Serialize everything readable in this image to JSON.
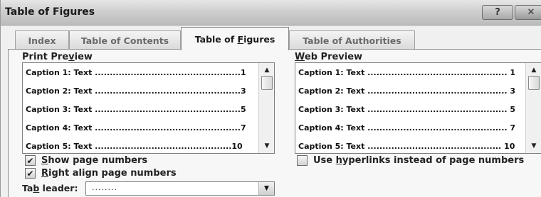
{
  "window": {
    "title": "Table of Figures",
    "help_label": "?",
    "close_label": "✕"
  },
  "tabs": [
    {
      "label_pre": "Index",
      "accel": "",
      "label_post": ""
    },
    {
      "label_pre": "Table of Contents",
      "accel": "",
      "label_post": ""
    },
    {
      "label_pre": "Table of ",
      "accel": "F",
      "label_post": "igures",
      "active": true
    },
    {
      "label_pre": "Table of Authorities",
      "accel": "",
      "label_post": ""
    }
  ],
  "print_preview": {
    "label_pre": "Print Pre",
    "label_accel": "v",
    "label_post": "iew",
    "rows": [
      "Caption 1: Text .................................................1",
      "Caption 2: Text .................................................3",
      "Caption 3: Text .................................................5",
      "Caption 4: Text .................................................7",
      "Caption 5: Text ..............................................10"
    ]
  },
  "web_preview": {
    "label_accel": "W",
    "label_post": "eb Preview",
    "rows": [
      "Caption 1: Text ............................................... 1",
      "Caption 2: Text ............................................... 3",
      "Caption 3: Text ............................................... 5",
      "Caption 4: Text ............................................... 7",
      "Caption 5: Text ............................................. 10"
    ]
  },
  "options": {
    "show_page_numbers": {
      "accel": "S",
      "rest": "how page numbers",
      "checked": true
    },
    "right_align": {
      "accel": "R",
      "rest": "ight align page numbers",
      "checked": true
    },
    "hyperlinks": {
      "pre": "Use ",
      "accel": "h",
      "rest": "yperlinks instead of page numbers",
      "checked": false
    }
  },
  "tab_leader": {
    "label_pre": "Ta",
    "label_accel": "b",
    "label_post": " leader:",
    "value": "........"
  },
  "glyphs": {
    "check": "✔",
    "arrow_up": "▲",
    "arrow_down": "▼"
  }
}
